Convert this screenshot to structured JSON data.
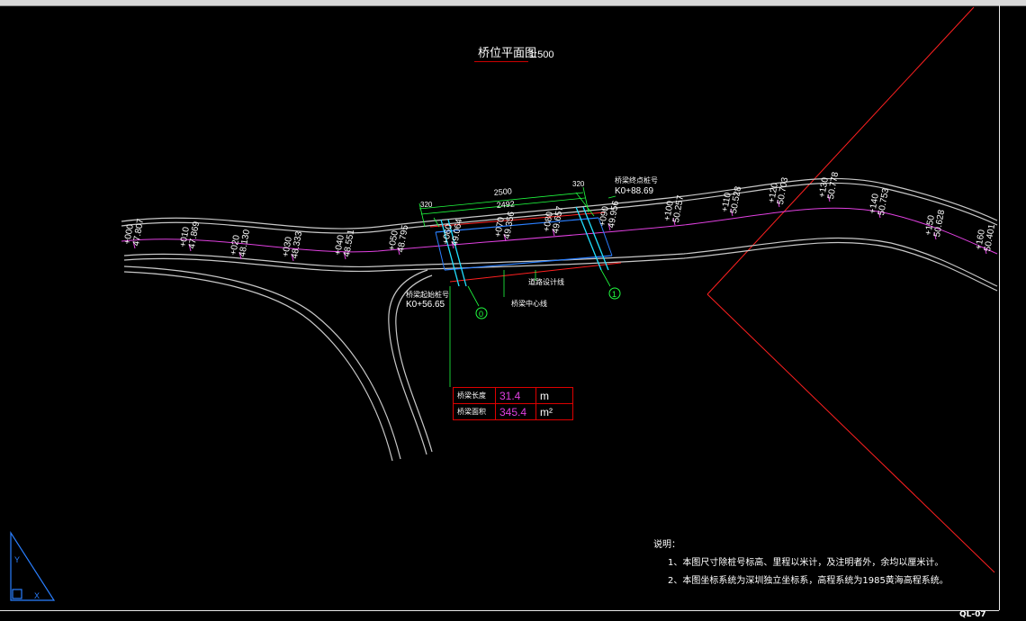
{
  "drawing": {
    "title": "桥位平面图",
    "scale": "1:500",
    "sheet_code": "QL-07"
  },
  "bridge": {
    "start_label": "桥梁起始桩号",
    "start_chainage": "K0+56.65",
    "end_label": "桥梁终点桩号",
    "end_chainage": "K0+88.69",
    "center_label": "桥梁中心线",
    "road_center_label": "道路设计线",
    "dim_2500": "2500",
    "dim_2492": "2492",
    "dim_320a": "320",
    "dim_320b": "320",
    "axis_0": "0",
    "axis_1": "1"
  },
  "stations": [
    {
      "st": "+000",
      "el": "47.807"
    },
    {
      "st": "+010",
      "el": "47.869"
    },
    {
      "st": "+020",
      "el": "48.130"
    },
    {
      "st": "+030",
      "el": "48.333"
    },
    {
      "st": "+040",
      "el": "48.551"
    },
    {
      "st": "+050",
      "el": "48.795"
    },
    {
      "st": "+060",
      "el": "49.064"
    },
    {
      "st": "+070",
      "el": "49.356"
    },
    {
      "st": "+080",
      "el": "49.657"
    },
    {
      "st": "+090",
      "el": "49.956"
    },
    {
      "st": "+100",
      "el": "50.257"
    },
    {
      "st": "+110",
      "el": "50.528"
    },
    {
      "st": "+120",
      "el": "50.703"
    },
    {
      "st": "+130",
      "el": "50.778"
    },
    {
      "st": "+140",
      "el": "50.753"
    },
    {
      "st": "+150",
      "el": "50.628"
    },
    {
      "st": "+160",
      "el": "50.401"
    }
  ],
  "summary_table": {
    "row1_label": "桥梁长度",
    "row1_value": "31.4",
    "row1_unit": "m",
    "row2_label": "桥梁面积",
    "row2_value": "345.4",
    "row2_unit": "m²"
  },
  "notes": {
    "heading": "说明：",
    "item1": "1、本图尺寸除桩号标高、里程以米计，及注明者外，余均以厘米计。",
    "item2": "2、本图坐标系统为深圳独立坐标系，高程系统为1985黄海高程系统。"
  },
  "colors": {
    "road_edge": "#c8c8c8",
    "center_line": "#e040e0",
    "bridge_outline": "#2a7fff",
    "bridge_edge": "#ff2020",
    "dim": "#20ff40",
    "pier": "#20e0ff",
    "frame_line": "#ff2020"
  }
}
